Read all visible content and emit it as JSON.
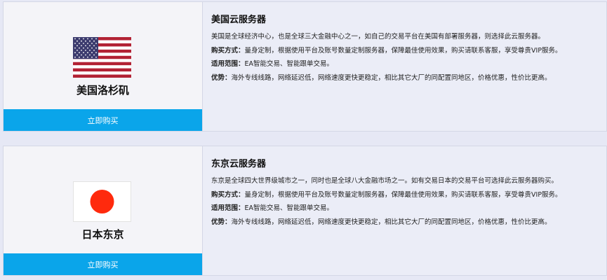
{
  "cards": [
    {
      "city": "美国洛杉矶",
      "flag_icon": "us-flag",
      "buy_label": "立即购买",
      "title": "美国云服务器",
      "desc": "美国是全球经济中心，也是全球三大金融中心之一，如自己的交易平台在美国有部署服务器，则选择此云服务器。",
      "purchase_label": "购买方式：",
      "purchase_text": "量身定制，根据使用平台及账号数量定制服务器，保障最佳使用效果，购买请联系客服，享受尊贵VIP服务。",
      "scope_label": "适用范围：",
      "scope_text": "EA智能交易、智能跟单交易。",
      "advantage_label": "优势：",
      "advantage_text": "海外专线线路，网络延迟低，网络速度更快更稳定，相比其它大厂的同配置同地区，价格优惠，性价比更高。"
    },
    {
      "city": "日本东京",
      "flag_icon": "japan-flag",
      "buy_label": "立即购买",
      "title": "东京云服务器",
      "desc": "东京是全球四大世界级城市之一，同时也是全球八大金融市场之一。如有交易日本的交易平台可选择此云服务器购买。",
      "purchase_label": "购买方式：",
      "purchase_text": "量身定制，根据使用平台及账号数量定制服务器，保障最佳使用效果，购买请联系客服，享受尊贵VIP服务。",
      "scope_label": "适用范围：",
      "scope_text": "EA智能交易、智能跟单交易。",
      "advantage_label": "优势：",
      "advantage_text": "海外专线线路，网络延迟低，网络速度更快更稳定，相比其它大厂的同配置同地区，价格优惠，性价比更高。"
    }
  ],
  "colors": {
    "accent": "#0aa5ea",
    "flag_red": "#b22234",
    "flag_blue": "#3c3b6e",
    "japan_red": "#ff2a0d"
  }
}
